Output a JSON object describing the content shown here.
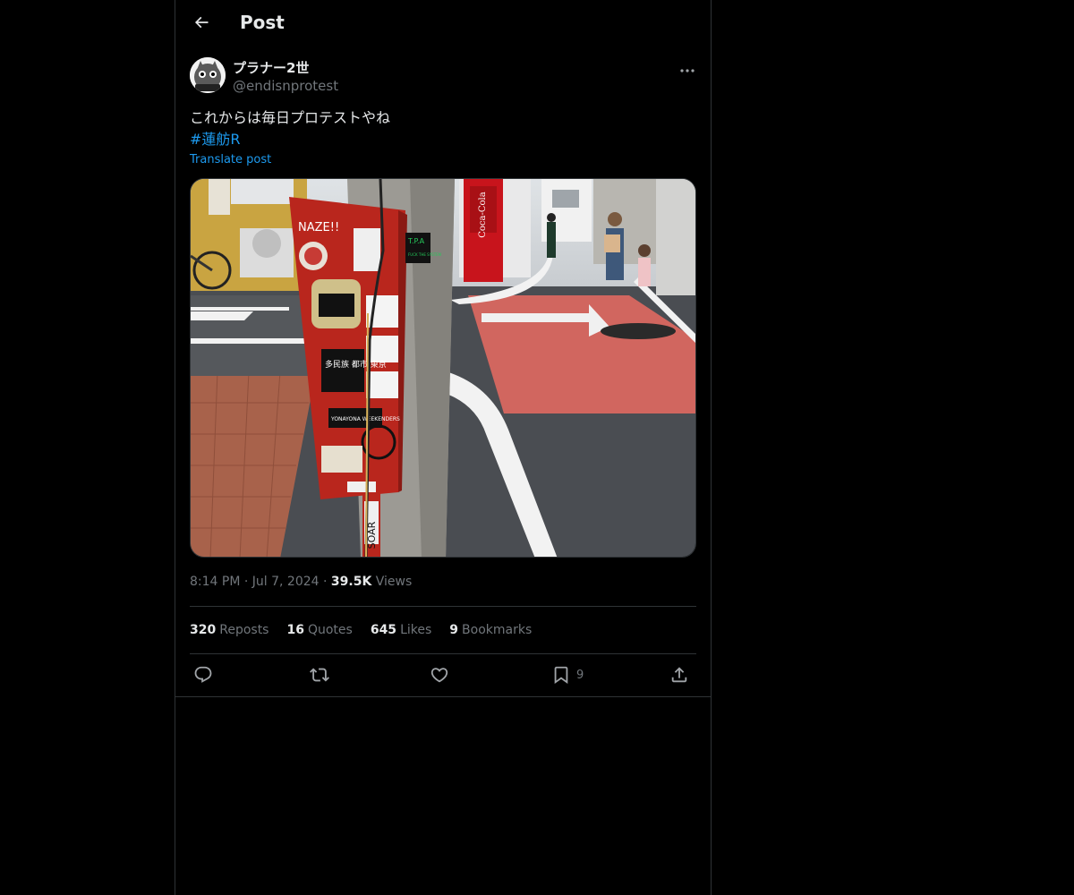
{
  "header": {
    "title": "Post"
  },
  "author": {
    "display_name": "プラナー2世",
    "handle": "@endisnprotest"
  },
  "post": {
    "text": "これからは毎日プロテストやね",
    "hashtag": "#蓮舫R",
    "translate_label": "Translate post"
  },
  "media_text": {
    "sticker1": "NAZE!!",
    "sticker2": "多民族 都市 東京",
    "sticker3": "YONAYONA WEEKENDERS",
    "sticker4": "SOAR",
    "sticker5": "T.P.A",
    "sticker6": "FUCK THE SYSTEM",
    "vending": "Coca-Cola"
  },
  "meta": {
    "time": "8:14 PM",
    "date": "Jul 7, 2024",
    "views_count": "39.5K",
    "views_label": "Views"
  },
  "stats": {
    "reposts_count": "320",
    "reposts_label": "Reposts",
    "quotes_count": "16",
    "quotes_label": "Quotes",
    "likes_count": "645",
    "likes_label": "Likes",
    "bookmarks_count": "9",
    "bookmarks_label": "Bookmarks"
  },
  "actions": {
    "bookmark_count": "9"
  },
  "icons": [
    "back-arrow-icon",
    "more-icon",
    "reply-icon",
    "repost-icon",
    "like-icon",
    "bookmark-icon",
    "share-icon"
  ],
  "colors": {
    "background": "#000000",
    "text": "#e7e9ea",
    "muted": "#71767b",
    "accent": "#1d9bf0",
    "border": "#2f3336"
  }
}
